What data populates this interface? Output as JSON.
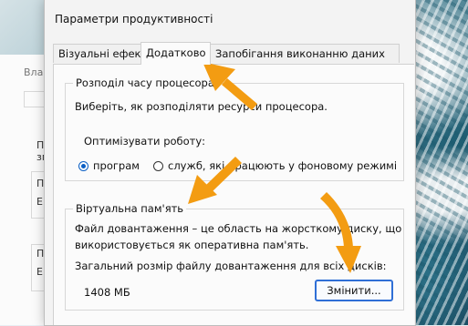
{
  "back_window": {
    "title_fragment": "Власт",
    "fragments": [
      "П",
      "зм",
      "П",
      "Е",
      "П",
      "Е"
    ]
  },
  "dialog": {
    "title": "Параметри продуктивності",
    "tabs": [
      {
        "label": "Візуальні ефекти"
      },
      {
        "label": "Додатково"
      },
      {
        "label": "Запобігання виконанню даних"
      }
    ],
    "cpu_group": {
      "title": "Розподіл часу процесора",
      "description": "Виберіть, як розподіляти ресурси процесора.",
      "optimize_label": "Оптимізувати роботу:",
      "options": [
        {
          "label": "програм",
          "selected": true
        },
        {
          "label": "служб, які працюють у фоновому режимі",
          "selected": false
        }
      ]
    },
    "vm_group": {
      "title": "Віртуальна пам'ять",
      "description_line1": "Файл довантаження – це область на жорсткому диску, що",
      "description_line2": "використовується як оперативна пам'ять.",
      "total_label": "Загальний розмір файлу довантаження для всіх дисків:",
      "size_value": "1408 МБ",
      "change_button": "Змінити..."
    }
  },
  "colors": {
    "accent": "#2f6fd6",
    "radio_selected": "#0a5fc4",
    "annotation_arrow": "#f39c12"
  }
}
